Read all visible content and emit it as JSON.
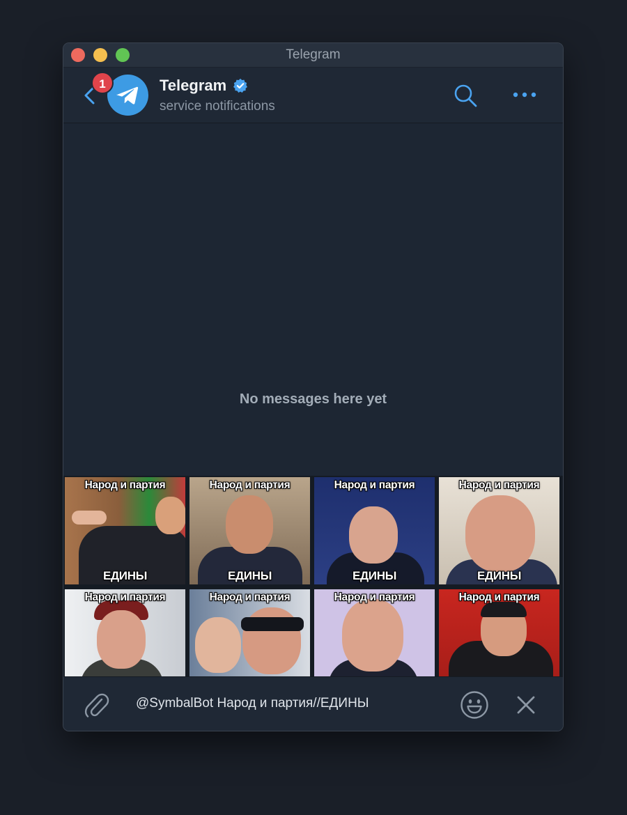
{
  "window": {
    "title": "Telegram"
  },
  "header": {
    "unread_badge": "1",
    "chat_name": "Telegram",
    "status": "service notifications",
    "verified": true
  },
  "chat": {
    "empty_text": "No messages here yet"
  },
  "results": [
    {
      "top_caption": "Народ и партия",
      "bottom_caption": "ЕДИНЫ"
    },
    {
      "top_caption": "Народ и партия",
      "bottom_caption": "ЕДИНЫ"
    },
    {
      "top_caption": "Народ и партия",
      "bottom_caption": "ЕДИНЫ"
    },
    {
      "top_caption": "Народ и партия",
      "bottom_caption": "ЕДИНЫ"
    },
    {
      "top_caption": "Народ и партия"
    },
    {
      "top_caption": "Народ и партия"
    },
    {
      "top_caption": "Народ и партия"
    },
    {
      "top_caption": "Народ и партия"
    }
  ],
  "composer": {
    "input_value": "@SymbalBot Народ и партия//ЕДИНЫ"
  },
  "colors": {
    "accent": "#4aa3f0",
    "badge": "#e0444b",
    "background": "#1d2633"
  },
  "icons": [
    "back-icon",
    "telegram-logo-icon",
    "verified-icon",
    "search-icon",
    "more-icon",
    "attach-icon",
    "emoji-icon",
    "close-icon"
  ]
}
